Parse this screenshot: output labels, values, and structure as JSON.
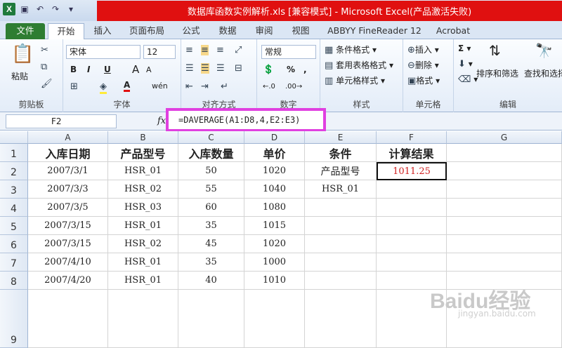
{
  "window": {
    "title": "数据库函数实例解析.xls  [兼容模式] - Microsoft Excel(产品激活失败)"
  },
  "tabs": [
    "文件",
    "开始",
    "插入",
    "页面布局",
    "公式",
    "数据",
    "审阅",
    "视图",
    "ABBYY FineReader 12",
    "Acrobat"
  ],
  "ribbon": {
    "clipboard": {
      "label": "剪贴板",
      "paste": "粘贴"
    },
    "font": {
      "label": "字体",
      "name": "宋体",
      "size": "12",
      "bold": "B",
      "italic": "I",
      "underline": "U",
      "grow": "A",
      "shrink": "A",
      "wen": "wén"
    },
    "align": {
      "label": "对齐方式"
    },
    "number": {
      "label": "数字",
      "format": "常规",
      "percent": "%",
      "comma": ","
    },
    "styles": {
      "label": "样式",
      "cond": "条件格式",
      "table": "套用表格格式",
      "cell": "单元格样式"
    },
    "cells": {
      "label": "单元格",
      "insert": "插入",
      "delete": "删除",
      "format": "格式"
    },
    "editing": {
      "label": "编辑",
      "sort": "排序和筛选",
      "find": "查找和选择"
    }
  },
  "formula": {
    "namebox": "F2",
    "fx": "fx",
    "value": "=DAVERAGE(A1:D8,4,E2:E3)"
  },
  "accent": {
    "file_tab": "#2e7d32",
    "title_highlight": "#e01010",
    "formula_highlight": "#e040e0",
    "result": "#d02020"
  },
  "columns": [
    "A",
    "B",
    "C",
    "D",
    "E",
    "F",
    "G"
  ],
  "rows": [
    [
      "入库日期",
      "产品型号",
      "入库数量",
      "单价",
      "条件",
      "计算结果",
      ""
    ],
    [
      "2007/3/1",
      "HSR_01",
      "50",
      "1020",
      "产品型号",
      "1011.25",
      ""
    ],
    [
      "2007/3/3",
      "HSR_02",
      "55",
      "1040",
      "HSR_01",
      "",
      ""
    ],
    [
      "2007/3/5",
      "HSR_03",
      "60",
      "1080",
      "",
      "",
      ""
    ],
    [
      "2007/3/15",
      "HSR_01",
      "35",
      "1015",
      "",
      "",
      ""
    ],
    [
      "2007/3/15",
      "HSR_02",
      "45",
      "1020",
      "",
      "",
      ""
    ],
    [
      "2007/4/10",
      "HSR_01",
      "35",
      "1000",
      "",
      "",
      ""
    ],
    [
      "2007/4/20",
      "HSR_01",
      "40",
      "1010",
      "",
      "",
      ""
    ],
    [
      "",
      "",
      "",
      "",
      "",
      "",
      ""
    ]
  ],
  "row_numbers": [
    "1",
    "2",
    "3",
    "4",
    "5",
    "6",
    "7",
    "8",
    "9"
  ],
  "watermark": {
    "brand": "Baidu经验",
    "url": "jingyan.baidu.com"
  }
}
